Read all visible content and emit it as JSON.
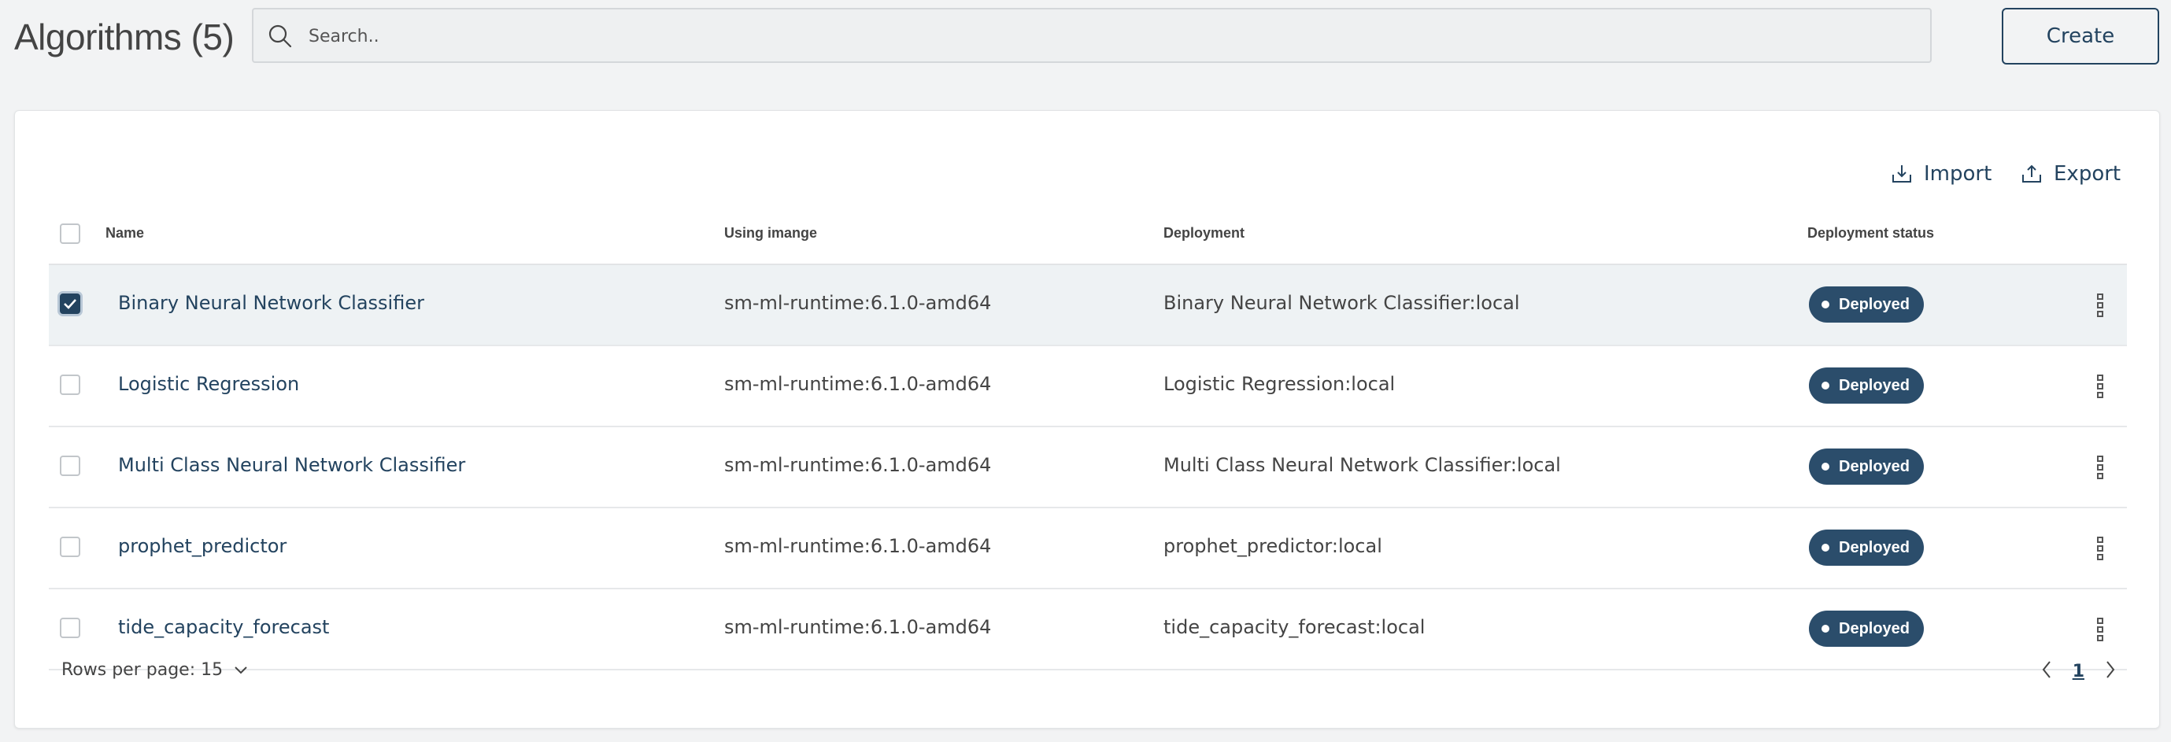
{
  "header": {
    "title": "Algorithms (5)",
    "search_placeholder": "Search..",
    "create_label": "Create"
  },
  "toolbar": {
    "import_label": "Import",
    "export_label": "Export"
  },
  "table": {
    "columns": {
      "name": "Name",
      "image": "Using imange",
      "deployment": "Deployment",
      "status": "Deployment status"
    },
    "rows": [
      {
        "name": "Binary Neural Network Classifier",
        "image": "sm-ml-runtime:6.1.0-amd64",
        "deployment": "Binary Neural Network Classifier:local",
        "status": "Deployed",
        "selected": true
      },
      {
        "name": "Logistic Regression",
        "image": "sm-ml-runtime:6.1.0-amd64",
        "deployment": "Logistic Regression:local",
        "status": "Deployed",
        "selected": false
      },
      {
        "name": "Multi Class Neural Network Classifier",
        "image": "sm-ml-runtime:6.1.0-amd64",
        "deployment": "Multi Class Neural Network Classifier:local",
        "status": "Deployed",
        "selected": false
      },
      {
        "name": "prophet_predictor",
        "image": "sm-ml-runtime:6.1.0-amd64",
        "deployment": "prophet_predictor:local",
        "status": "Deployed",
        "selected": false
      },
      {
        "name": "tide_capacity_forecast",
        "image": "sm-ml-runtime:6.1.0-amd64",
        "deployment": "tide_capacity_forecast:local",
        "status": "Deployed",
        "selected": false
      }
    ]
  },
  "footer": {
    "rows_per_page": "Rows per page: 15",
    "current_page": "1"
  },
  "colors": {
    "accent": "#23435f",
    "badge": "#2b4d6b",
    "background": "#f2f3f4"
  },
  "icons": {
    "search": "search-icon",
    "import": "import-icon",
    "export": "export-icon",
    "kebab": "more-vertical-icon",
    "chevron_down": "chevron-down-icon",
    "chevron_left": "chevron-left-icon",
    "chevron_right": "chevron-right-icon"
  }
}
